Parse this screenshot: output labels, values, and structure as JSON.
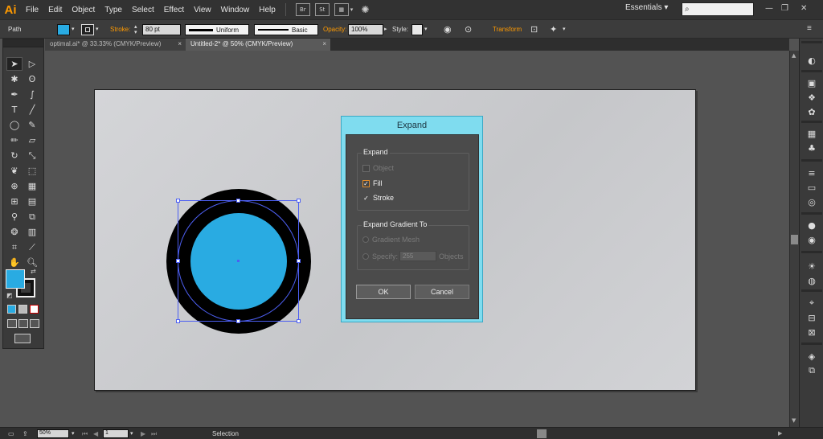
{
  "app": {
    "logo": "Ai"
  },
  "menu": [
    "File",
    "Edit",
    "Object",
    "Type",
    "Select",
    "Effect",
    "View",
    "Window",
    "Help"
  ],
  "menubar_icons": {
    "bridge": "Br",
    "stock": "St"
  },
  "workspace": {
    "label": "Essentials",
    "arrow": "▾"
  },
  "window_controls": {
    "minimize": "—",
    "restore": "❐",
    "close": "✕"
  },
  "control_bar": {
    "selection_type": "Path",
    "stroke_label": "Stroke:",
    "stroke_weight": "80 pt",
    "profile_label": "Uniform",
    "brush_label": "Basic",
    "opacity_label": "Opacity:",
    "opacity_value": "100%",
    "style_label": "Style:",
    "transform_label": "Transform",
    "fill_color": "#29abe2"
  },
  "tabs": [
    {
      "label": "optimal.ai* @ 33.33% (CMYK/Preview)",
      "close": "×"
    },
    {
      "label": "Untitled-2* @ 50% (CMYK/Preview)",
      "close": "×"
    }
  ],
  "tools": {
    "icons": [
      "selection-icon",
      "direct-selection-icon",
      "magic-wand-icon",
      "lasso-icon",
      "pen-icon",
      "curvature-icon",
      "type-icon",
      "line-icon",
      "ellipse-icon",
      "paintbrush-icon",
      "pencil-icon",
      "eraser-icon",
      "rotate-icon",
      "scale-icon",
      "warp-icon",
      "free-transform-icon",
      "shape-builder-icon",
      "perspective-icon",
      "mesh-icon",
      "gradient-icon",
      "eyedropper-icon",
      "blend-icon",
      "symbol-sprayer-icon",
      "column-graph-icon",
      "artboard-icon",
      "slice-icon",
      "hand-icon",
      "zoom-icon"
    ],
    "fill_color": "#29abe2",
    "stroke_color": "#000000"
  },
  "artwork": {
    "ring_color": "#000000",
    "inner_color": "#29abe2",
    "selection_color": "#4d5ff2"
  },
  "dialog": {
    "title": "Expand",
    "expand_group": "Expand",
    "object": "Object",
    "fill": "Fill",
    "stroke": "Stroke",
    "fill_checked": true,
    "stroke_checked": true,
    "object_checked": false,
    "gradient_group": "Expand Gradient To",
    "gradient_mesh": "Gradient Mesh",
    "specify": "Specify:",
    "specify_value": "255",
    "objects": "Objects",
    "ok": "OK",
    "cancel": "Cancel",
    "title_bar_color": "#7fdcef"
  },
  "status": {
    "zoom": "50%",
    "artboard_number": "1",
    "tool": "Selection"
  }
}
